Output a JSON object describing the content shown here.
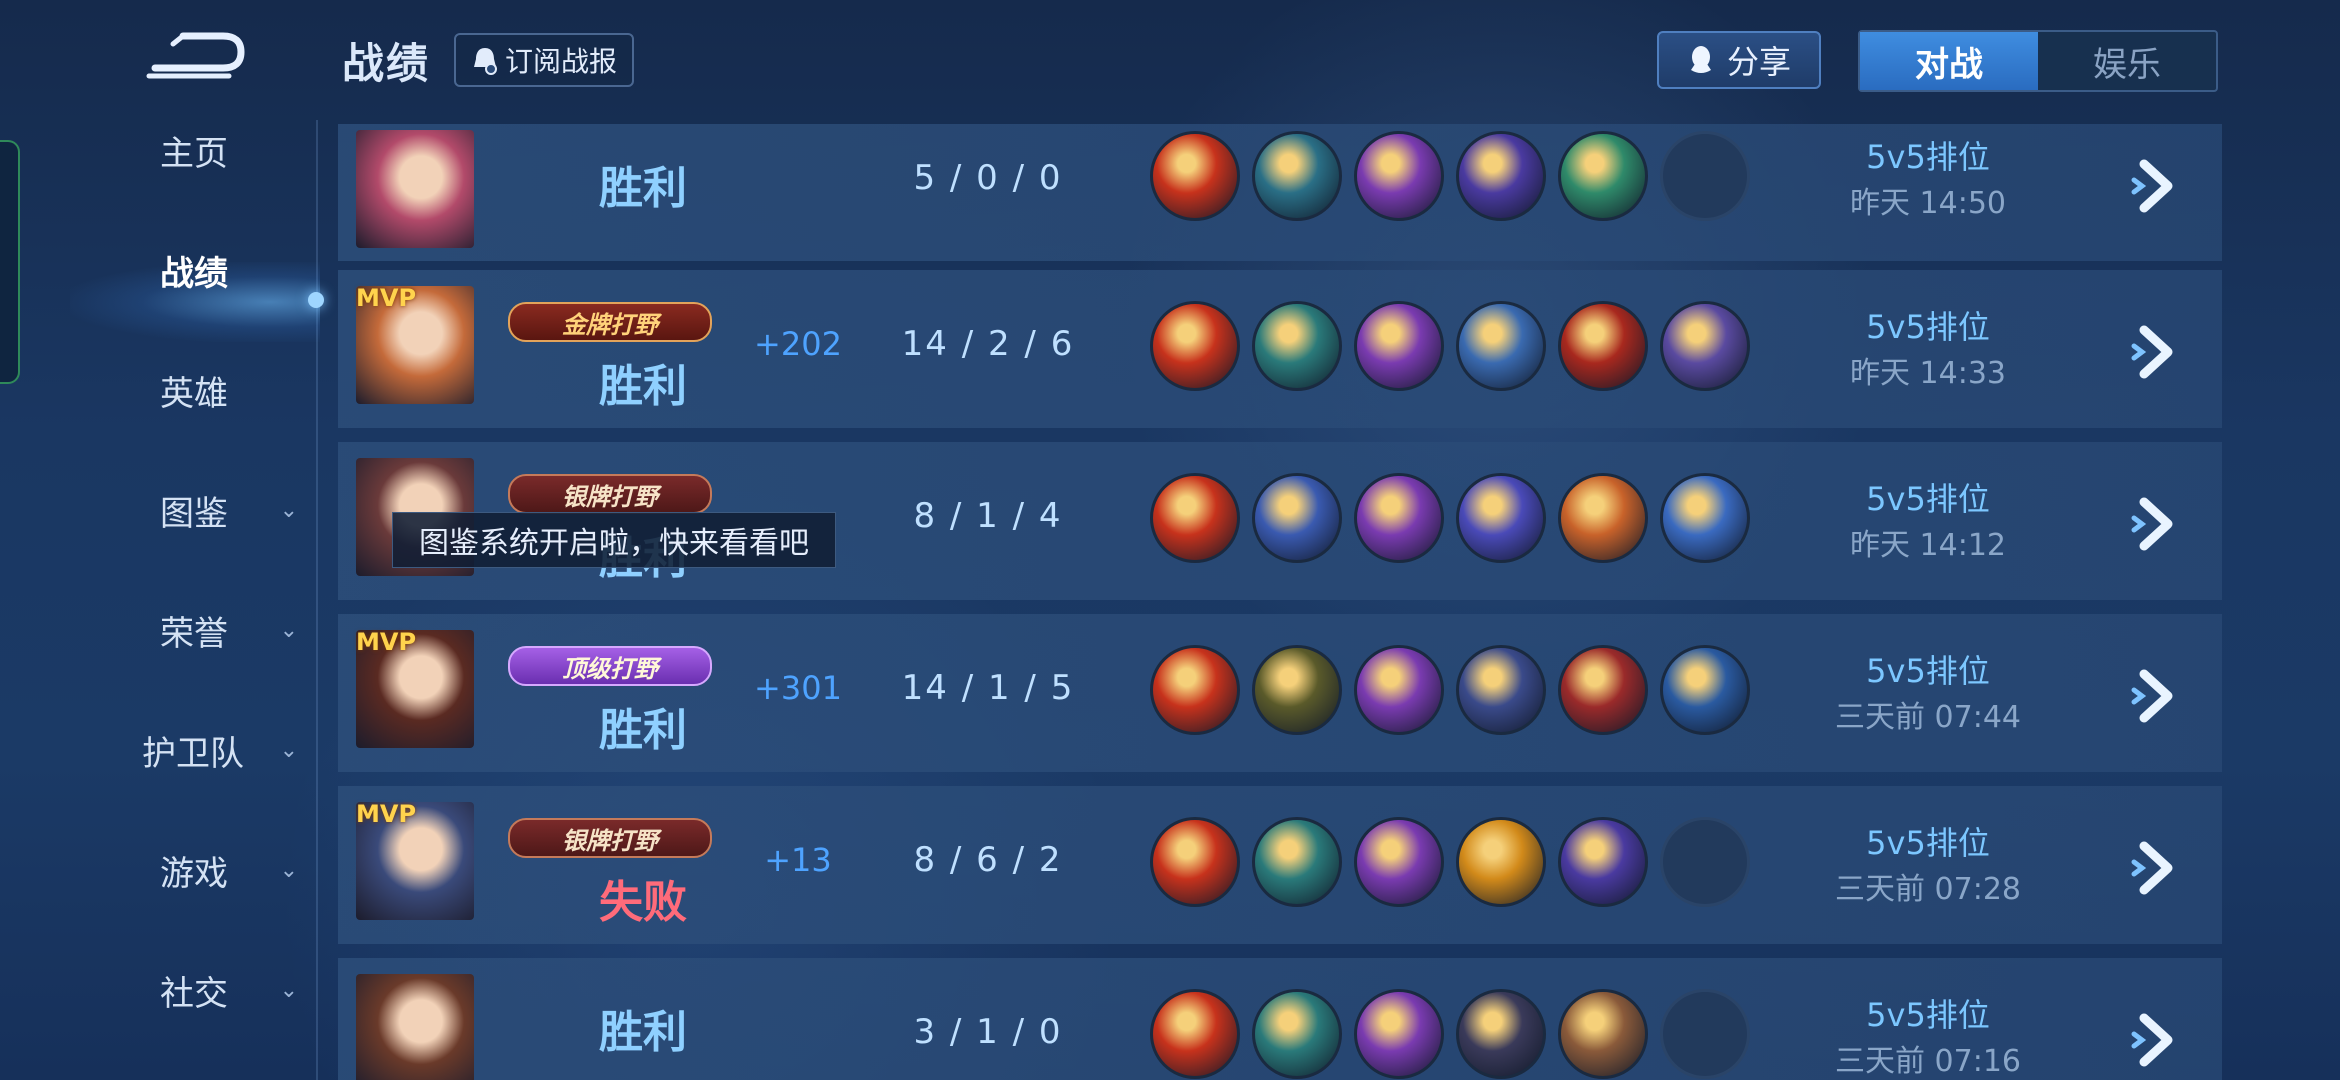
{
  "header": {
    "title": "战绩",
    "subscribe_label": "订阅战报",
    "share_label": "分享",
    "tabs": [
      {
        "label": "对战",
        "active": true
      },
      {
        "label": "娱乐",
        "active": false
      }
    ]
  },
  "sidebar": {
    "items": [
      {
        "label": "主页",
        "has_chevron": false,
        "active": false
      },
      {
        "label": "战绩",
        "has_chevron": false,
        "active": true
      },
      {
        "label": "英雄",
        "has_chevron": false,
        "active": false
      },
      {
        "label": "图鉴",
        "has_chevron": true,
        "active": false
      },
      {
        "label": "荣誉",
        "has_chevron": true,
        "active": false
      },
      {
        "label": "护卫队",
        "has_chevron": true,
        "active": false
      },
      {
        "label": "游戏",
        "has_chevron": true,
        "active": false
      },
      {
        "label": "社交",
        "has_chevron": true,
        "active": false
      }
    ]
  },
  "tooltip": "图鉴系统开启啦，快来看看吧",
  "matches": [
    {
      "mvp": "",
      "badge": "",
      "badge_style": "",
      "result": "胜利",
      "result_type": "win",
      "delta": "",
      "kda": "5 / 0 / 0",
      "mode": "5v5排位",
      "time": "昨天 14:50",
      "avatar_color": "#b24a6a"
    },
    {
      "mvp": "MVP",
      "badge": "金牌打野",
      "badge_style": "gold",
      "result": "胜利",
      "result_type": "win",
      "delta": "+202",
      "kda": "14 / 2 / 6",
      "mode": "5v5排位",
      "time": "昨天 14:33",
      "avatar_color": "#c46a3a"
    },
    {
      "mvp": "",
      "badge": "银牌打野",
      "badge_style": "",
      "result": "胜利",
      "result_type": "win",
      "delta": "",
      "kda": "8 / 1 / 4",
      "mode": "5v5排位",
      "time": "昨天 14:12",
      "avatar_color": "#6a3a3a"
    },
    {
      "mvp": "MVP",
      "badge": "顶级打野",
      "badge_style": "purple",
      "result": "胜利",
      "result_type": "win",
      "delta": "+301",
      "kda": "14 / 1 / 5",
      "mode": "5v5排位",
      "time": "三天前 07:44",
      "avatar_color": "#5a2a22"
    },
    {
      "mvp": "MVP",
      "badge": "银牌打野",
      "badge_style": "",
      "result": "失败",
      "result_type": "lose",
      "delta": "+13",
      "kda": "8 / 6 / 2",
      "mode": "5v5排位",
      "time": "三天前 07:28",
      "avatar_color": "#3a4a7a"
    },
    {
      "mvp": "",
      "badge": "",
      "badge_style": "",
      "result": "胜利",
      "result_type": "win",
      "delta": "",
      "kda": "3 / 1 / 0",
      "mode": "5v5排位",
      "time": "三天前 07:16",
      "avatar_color": "#6a3a2a"
    }
  ],
  "item_icons": [
    [
      "#c7321c",
      "#2a6f86",
      "#7a3bb0",
      "#4a3aa0",
      "#2f8a6a",
      ""
    ],
    [
      "#c7321c",
      "#2a7a7a",
      "#7a3bb0",
      "#3a6ab0",
      "#a8281e",
      "#5a4aa0"
    ],
    [
      "#c7321c",
      "#3a5ab0",
      "#7a3bb0",
      "#4a4ab8",
      "#c8622a",
      "#3a6ac0"
    ],
    [
      "#c7321c",
      "#5a5a2a",
      "#7a3bb0",
      "#3a4a8a",
      "#9a2a2a",
      "#2a5aa0"
    ],
    [
      "#c7321c",
      "#2a7a7a",
      "#7a3bb0",
      "#d28a1a",
      "#4a3aa0",
      ""
    ],
    [
      "#c7321c",
      "#2a7a7a",
      "#7a3bb0",
      "#3a3a5a",
      "#8a5a3a",
      ""
    ]
  ]
}
